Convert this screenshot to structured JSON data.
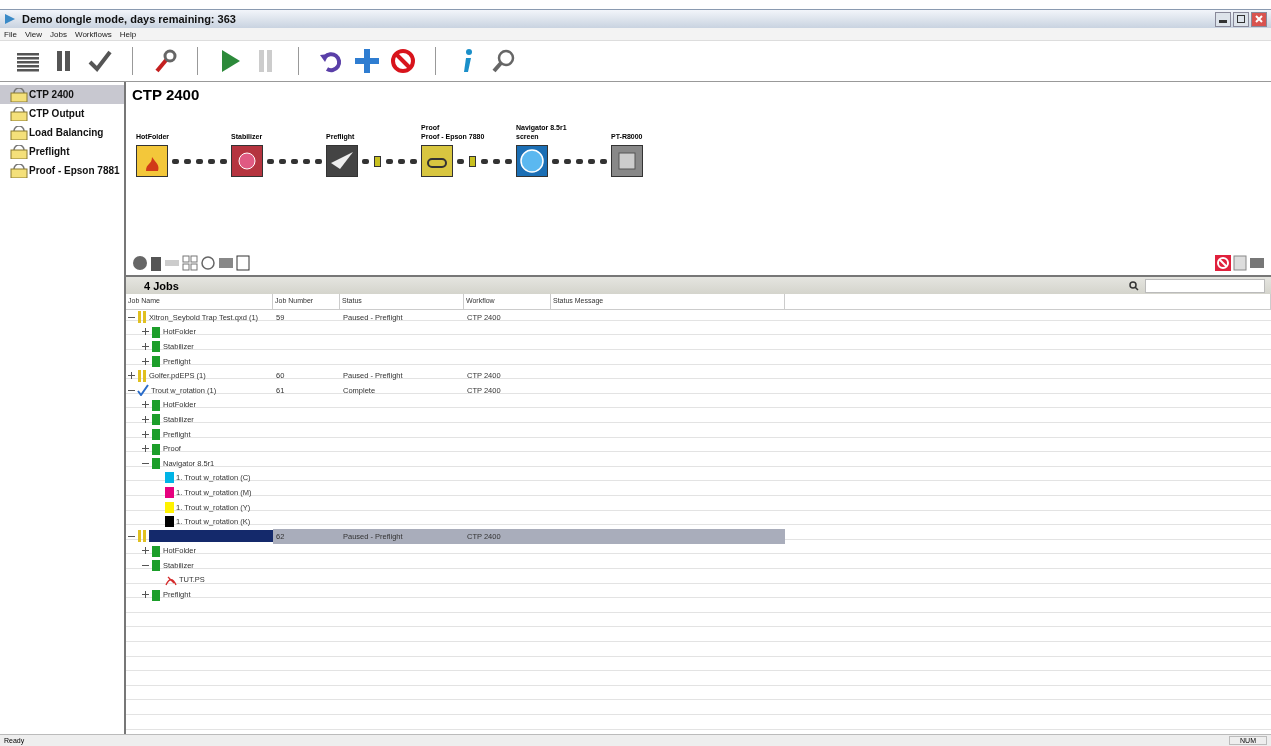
{
  "window": {
    "title": "Demo dongle mode, days remaining: 363"
  },
  "menu": [
    "File",
    "View",
    "Jobs",
    "Workflows",
    "Help"
  ],
  "sidebar": {
    "items": [
      {
        "label": "CTP 2400",
        "selected": true
      },
      {
        "label": "CTP Output",
        "selected": false
      },
      {
        "label": "Load Balancing",
        "selected": false
      },
      {
        "label": "Preflight",
        "selected": false
      },
      {
        "label": "Proof - Epson 7881",
        "selected": false
      }
    ]
  },
  "workflow": {
    "title": "CTP 2400",
    "nodes": [
      {
        "kind": "hotfolder",
        "label": "HotFolder",
        "paused_after": false
      },
      {
        "kind": "stabilizer",
        "label": "Stabilizer",
        "paused_after": false
      },
      {
        "kind": "preflight",
        "label": "Preflight",
        "paused_after": true
      },
      {
        "kind": "proof",
        "label": "Proof",
        "sublabel": "Proof - Epson 7880",
        "paused_after": true
      },
      {
        "kind": "navigator",
        "label": "Navigator 8.5r1",
        "sublabel": "screen",
        "paused_after": false
      },
      {
        "kind": "output",
        "label": "PT-R8000"
      }
    ]
  },
  "jobs": {
    "count_label": "4 Jobs",
    "columns": [
      "Job Name",
      "Job Number",
      "Status",
      "Workflow",
      "Status Message"
    ],
    "rows": [
      {
        "kind": "paused",
        "name": "Xitron_Seybold Trap Test.qxd (1)",
        "number": "59",
        "status": "Paused - Preflight",
        "workflow": "CTP 2400",
        "expanded": true,
        "selected": false,
        "children": [
          {
            "kind": "step",
            "name": "HotFolder",
            "expanded": false
          },
          {
            "kind": "step",
            "name": "Stabilizer",
            "expanded": false
          },
          {
            "kind": "step",
            "name": "Preflight",
            "expanded": false
          }
        ]
      },
      {
        "kind": "paused",
        "name": "Golfer.pdEPS (1)",
        "number": "60",
        "status": "Paused - Preflight",
        "workflow": "CTP 2400",
        "expanded": false,
        "selected": false
      },
      {
        "kind": "complete",
        "name": "Trout w_rotation (1)",
        "number": "61",
        "status": "Complete",
        "workflow": "CTP 2400",
        "expanded": true,
        "selected": false,
        "children": [
          {
            "kind": "step",
            "name": "HotFolder",
            "expanded": false
          },
          {
            "kind": "step",
            "name": "Stabilizer",
            "expanded": false
          },
          {
            "kind": "step",
            "name": "Preflight",
            "expanded": false
          },
          {
            "kind": "step",
            "name": "Proof",
            "expanded": false
          },
          {
            "kind": "step",
            "name": "Navigator 8.5r1",
            "expanded": true,
            "children": [
              {
                "kind": "separation",
                "name": "1. Trout w_rotation (C)",
                "color": "#00b4e6"
              },
              {
                "kind": "separation",
                "name": "1. Trout w_rotation (M)",
                "color": "#e6007e"
              },
              {
                "kind": "separation",
                "name": "1. Trout w_rotation (Y)",
                "color": "#fff200"
              },
              {
                "kind": "separation",
                "name": "1. Trout w_rotation (K)",
                "color": "#000000"
              }
            ]
          }
        ]
      },
      {
        "kind": "paused",
        "number": "62",
        "status": "Paused - Preflight",
        "workflow": "CTP 2400",
        "expanded": true,
        "selected": true,
        "children": [
          {
            "kind": "step",
            "name": "HotFolder",
            "expanded": false
          },
          {
            "kind": "step",
            "name": "Stabilizer",
            "expanded": true,
            "children": [
              {
                "kind": "file",
                "name": "TUT.PS"
              }
            ]
          },
          {
            "kind": "step",
            "name": "Preflight",
            "expanded": false
          }
        ]
      }
    ]
  },
  "status_bar": {
    "text": "Ready",
    "indicator": "NUM"
  }
}
